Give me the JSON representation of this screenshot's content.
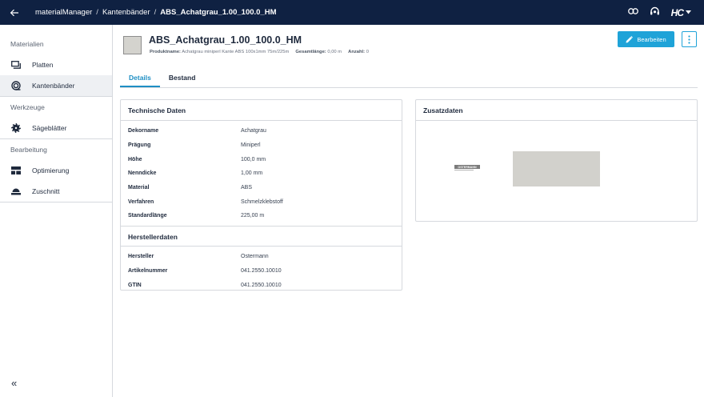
{
  "header": {
    "breadcrumbs": [
      "materialManager",
      "Kantenbänder",
      "ABS_Achatgrau_1.00_100.0_HM"
    ],
    "separator": "/",
    "brand": "HC"
  },
  "sidebar": {
    "sections": [
      {
        "label": "Materialien",
        "items": [
          {
            "label": "Platten"
          },
          {
            "label": "Kantenbänder"
          }
        ]
      },
      {
        "label": "Werkzeuge",
        "items": [
          {
            "label": "Sägeblätter"
          }
        ]
      },
      {
        "label": "Bearbeitung",
        "items": [
          {
            "label": "Optimierung"
          },
          {
            "label": "Zuschnitt"
          }
        ]
      }
    ],
    "collapse_glyph": "«"
  },
  "product": {
    "title": "ABS_Achatgrau_1.00_100.0_HM",
    "meta": {
      "produktname_label": "Produktname:",
      "produktname": "Achatgrau miniperl Kante ABS 100x1mm 75m/225m",
      "gesamtlaenge_label": "Gesamtlänge:",
      "gesamtlaenge": "0,00 m",
      "anzahl_label": "Anzahl:",
      "anzahl": "0"
    },
    "edit_label": "Bearbeiten",
    "swatch_color": "#d4d3ce"
  },
  "tabs": [
    {
      "label": "Details"
    },
    {
      "label": "Bestand"
    }
  ],
  "technische": {
    "title": "Technische Daten",
    "rows": [
      {
        "k": "Dekorname",
        "v": "Achatgrau"
      },
      {
        "k": "Prägung",
        "v": "Miniperl"
      },
      {
        "k": "Höhe",
        "v": "100,0 mm"
      },
      {
        "k": "Nenndicke",
        "v": "1,00 mm"
      },
      {
        "k": "Material",
        "v": "ABS"
      },
      {
        "k": "Verfahren",
        "v": "Schmelzklebstoff"
      },
      {
        "k": "Standardlänge",
        "v": "225,00 m"
      }
    ]
  },
  "hersteller": {
    "title": "Herstellerdaten",
    "rows": [
      {
        "k": "Hersteller",
        "v": "Ostermann"
      },
      {
        "k": "Artikelnummer",
        "v": "041.2550.10010"
      },
      {
        "k": "GTIN",
        "v": "041.2550.10010"
      }
    ]
  },
  "zusatz": {
    "title": "Zusatzdaten",
    "logo_text": "OSTERMANN",
    "sample_color": "#d2d1cc"
  },
  "colors": {
    "topbar": "#0f2142",
    "accent": "#1fa3d8",
    "tab_active": "#1f8fc4"
  }
}
